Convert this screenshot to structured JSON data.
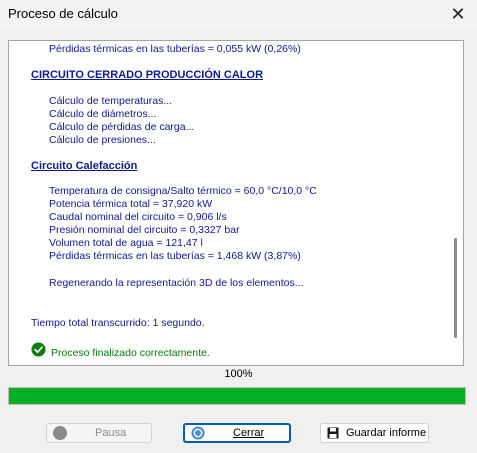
{
  "window": {
    "title": "Proceso de cálculo",
    "close_glyph": "✕"
  },
  "log": {
    "lines": [
      "Pérdidas térmicas en las tuberías = 0,055 kW (0,26%)",
      "CIRCUITO CERRADO PRODUCCIÓN CALOR",
      "Cálculo de temperaturas...",
      "Cálculo de diámetros...",
      "Cálculo de pérdidas de carga...",
      "Cálculo de presiones...",
      "Circuito Calefacción",
      "Temperatura de consigna/Salto térmico = 60,0 °C/10,0 °C",
      "Potencia térmica total = 37,920 kW",
      "Caudal nominal del circuito = 0,906 l/s",
      "Presión nominal del circuito = 0,3327 bar",
      "Volumen total de agua = 121,47 l",
      "Pérdidas térmicas en las tuberías = 1,468 kW (3,87%)",
      "Regenerando la representación 3D de los elementos...",
      "Tiempo total transcurrido: 1 segundo.",
      "Proceso finalizado correctamente."
    ],
    "ok_icon": "check-circle-icon"
  },
  "progress": {
    "label": "100%",
    "value": 1.0,
    "color": "#06b025"
  },
  "buttons": {
    "pausa": {
      "label": "Pausa",
      "icon": "pause-circle-icon",
      "enabled": false
    },
    "cerrar": {
      "label": "Cerrar",
      "icon": "close-circle-icon"
    },
    "guardar": {
      "label": "Guardar informe",
      "icon": "floppy-disk-icon"
    }
  }
}
